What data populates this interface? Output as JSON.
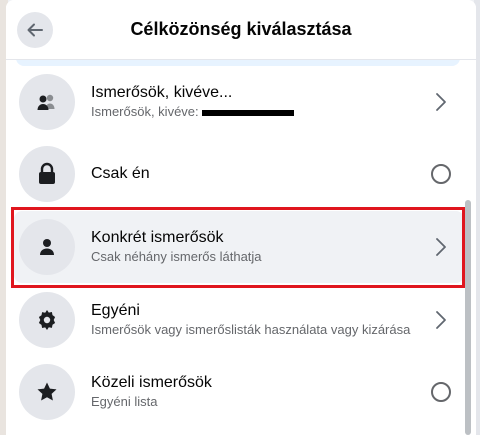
{
  "dialog": {
    "title": "Célközönség kiválasztása",
    "back_icon": "arrow-left-icon"
  },
  "options": [
    {
      "label": "Ismerősök, kivéve...",
      "sub": "Ismerősök, kivéve:",
      "icon": "friends-except-icon",
      "trail": "chevron-right-icon"
    },
    {
      "label": "Csak én",
      "sub": "",
      "icon": "lock-icon",
      "trail": "radio-unselected"
    },
    {
      "label": "Konkrét ismerősök",
      "sub": "Csak néhány ismerős láthatja",
      "icon": "person-icon",
      "trail": "chevron-right-icon",
      "highlighted": true
    },
    {
      "label": "Egyéni",
      "sub": "Ismerősök vagy ismerőslisták használata vagy kizárása",
      "icon": "gear-icon",
      "trail": "chevron-right-icon"
    },
    {
      "label": "Közeli ismerősök",
      "sub": "Egyéni lista",
      "icon": "star-icon",
      "trail": "radio-unselected"
    }
  ],
  "colors": {
    "highlight": "#e0161e",
    "icon_bg": "#e4e6eb",
    "text_secondary": "#65676b"
  }
}
